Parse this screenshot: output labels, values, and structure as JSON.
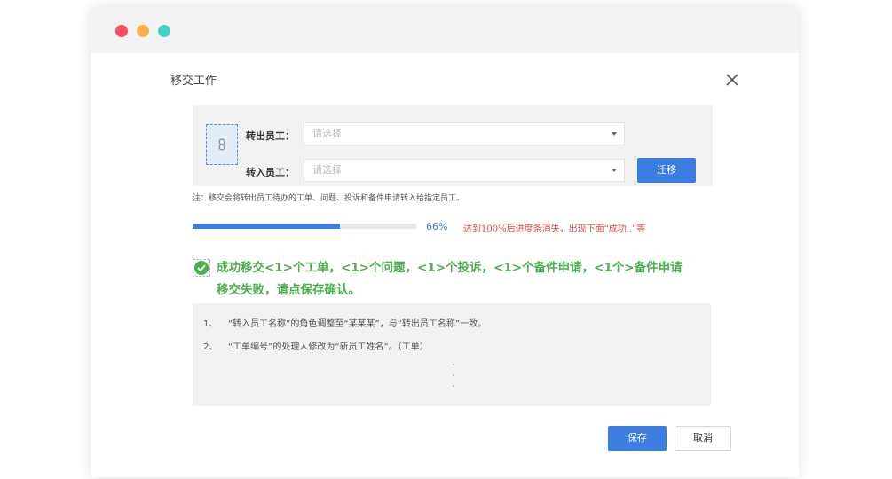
{
  "dialog": {
    "title": "移交工作"
  },
  "form": {
    "from_label": "转出员工：",
    "from_placeholder": "请选择",
    "to_label": "转入员工：",
    "to_placeholder": "请选择",
    "transfer_button": "迁移"
  },
  "note": "注：移交会将转出员工待办的工单、问题、投诉和备件申请转入给指定员工。",
  "progress": {
    "value_percent": 66,
    "label": "66%",
    "hint": "达到100%后进度条消失，出现下面“成功..”等"
  },
  "result": {
    "line1": "成功移交<1>个工单，<1>个问题，<1>个投诉，<1>个备件申请，<1个>备件申请",
    "line2": "移交失败，请点保存确认。"
  },
  "details": [
    {
      "num": "1、",
      "text": "“转入员工名称”的角色调整至“某某某”，与“转出员工名称”一致。"
    },
    {
      "num": "2、",
      "text": "“工单编号”的处理人修改为“新员工姓名”。（工单）"
    }
  ],
  "footer": {
    "save": "保存",
    "cancel": "取消"
  },
  "colors": {
    "primary": "#3b7de0",
    "success": "#4cae4c",
    "hint": "#e04b4b"
  }
}
